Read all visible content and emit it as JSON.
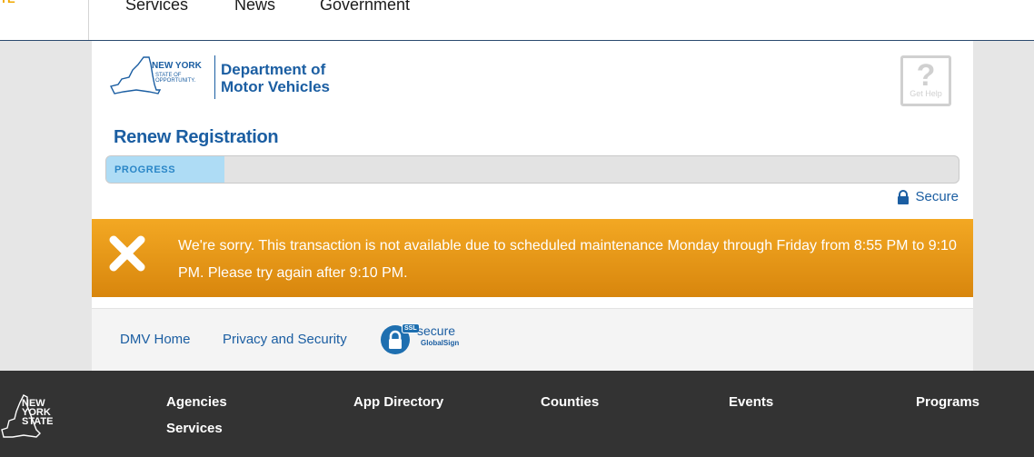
{
  "top_nav": {
    "logo_fragment": "TE",
    "items": [
      "Services",
      "News",
      "Government"
    ]
  },
  "header": {
    "ny_wordmark": "NEW YORK",
    "ny_tagline": "STATE OF OPPORTUNITY.",
    "department": [
      "Department of",
      "Motor Vehicles"
    ],
    "help_label": "Get Help",
    "help_glyph": "?"
  },
  "page": {
    "title": "Renew Registration",
    "progress_label": "PROGRESS",
    "progress_fraction": 0.139,
    "secure_label": "Secure"
  },
  "alert": {
    "message": "We're sorry. This transaction is not available due to scheduled maintenance Monday through Friday from 8:55 PM to 9:10 PM. Please try again after 9:10 PM."
  },
  "footer_links": {
    "home": "DMV Home",
    "privacy": "Privacy and Security",
    "ssl_badge": "SSL",
    "ssl_word": "secure",
    "ssl_brand": "GlobalSign"
  },
  "bottom": {
    "logo_lines": [
      "NEW",
      "YORK",
      "STATE"
    ],
    "links": [
      "Agencies",
      "App Directory",
      "Counties",
      "Events",
      "Programs",
      "Services"
    ]
  },
  "colors": {
    "brand_blue": "#1b5ea2",
    "alert_orange": "#f3a823",
    "progress_fill": "#aedcf5",
    "footer_dark": "#333333"
  }
}
